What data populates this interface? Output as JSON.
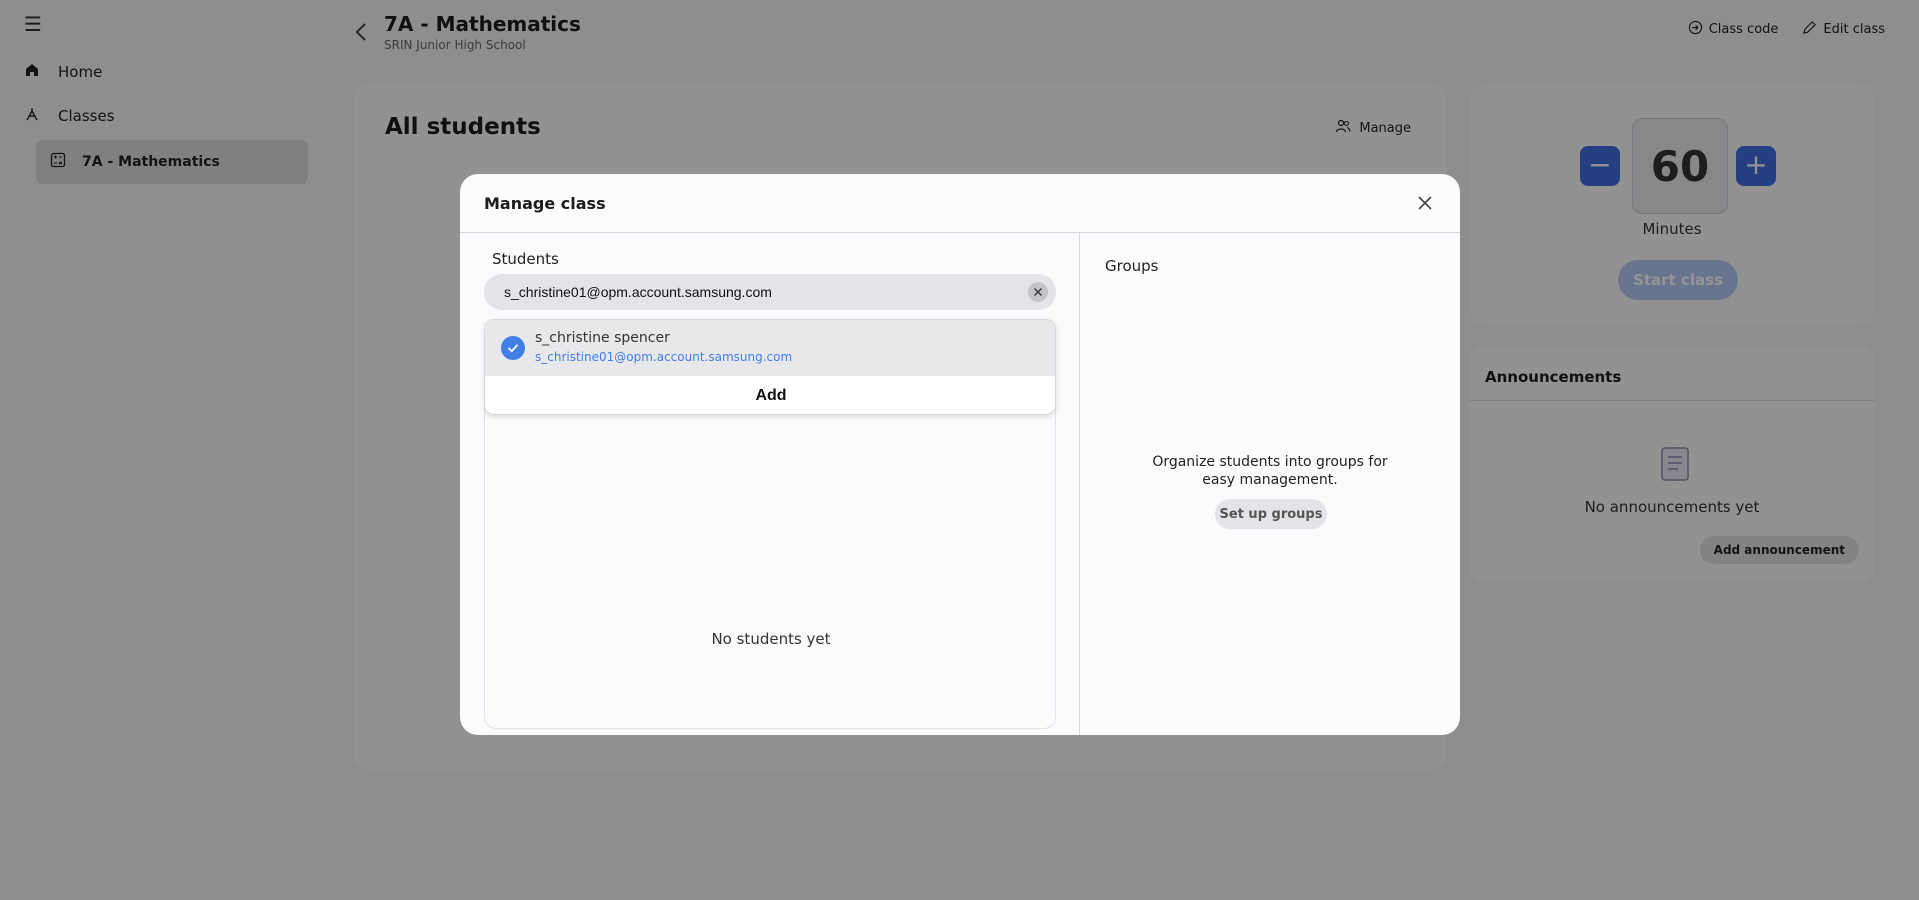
{
  "sidebar": {
    "items": [
      {
        "label": "Home",
        "icon": "home-icon"
      },
      {
        "label": "Classes",
        "icon": "classes-icon"
      },
      {
        "label": "7A - Mathematics",
        "icon": "class-icon"
      }
    ]
  },
  "header": {
    "title": "7A - Mathematics",
    "subtitle": "SRIN Junior High School",
    "class_code_label": "Class code",
    "edit_class_label": "Edit class"
  },
  "main": {
    "title": "All students",
    "manage_label": "Manage"
  },
  "timer": {
    "minus": "−",
    "plus": "+",
    "value": "60",
    "unit": "Minutes",
    "start_label": "Start class"
  },
  "announcements": {
    "title": "Announcements",
    "empty_text": "No announcements yet",
    "add_label": "Add announcement"
  },
  "modal": {
    "title": "Manage class",
    "students_label": "Students",
    "search_value": "s_christine01@opm.account.samsung.com",
    "suggestion": {
      "name": "s_christine spencer",
      "email": "s_christine01@opm.account.samsung.com",
      "selected": true
    },
    "add_label": "Add",
    "no_students": "No students yet",
    "groups_label": "Groups",
    "groups_desc": "Organize students into groups for easy management.",
    "setup_groups_label": "Set up groups"
  },
  "colors": {
    "accent": "#3e6fe0",
    "link": "#3f7fe6",
    "overlay": "rgba(0,0,0,0.42)"
  }
}
